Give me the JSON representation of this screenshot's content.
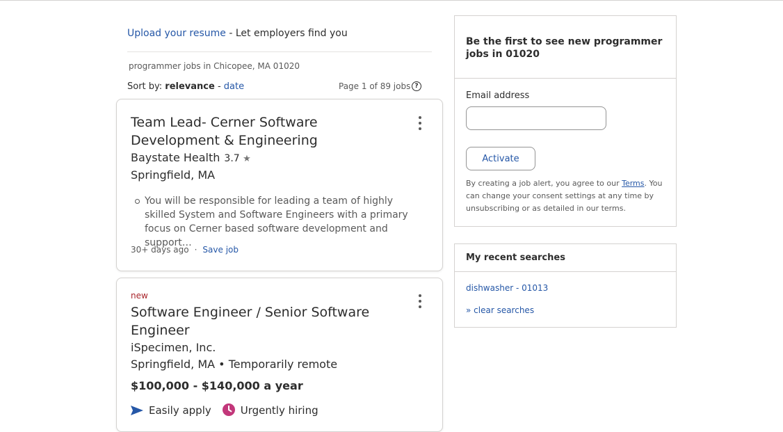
{
  "upload": {
    "link": "Upload your resume",
    "text": " - Let employers find you"
  },
  "search_location": "programmer jobs in Chicopee, MA 01020",
  "sort": {
    "label": "Sort by: ",
    "active": "relevance",
    "sep": " - ",
    "alt": "date"
  },
  "paging": {
    "text": "Page 1 of 89 jobs",
    "help_icon": "?"
  },
  "jobs": [
    {
      "title": "Team Lead- Cerner Software Development & Engineering",
      "company": "Baystate Health",
      "rating": "3.7",
      "star": "★",
      "location": "Springfield, MA",
      "snippet": "You will be responsible for leading a team of highly skilled System and Software Engineers with a primary focus on Cerner based software development and support…",
      "posted": "30+ days ago",
      "dot": "·",
      "save": "Save job"
    },
    {
      "badge": "new",
      "title": "Software Engineer / Senior Software Engineer",
      "company": "iSpecimen, Inc.",
      "location": "Springfield, MA  •  Temporarily remote",
      "salary": "$100,000 - $140,000 a year",
      "tag1": "Easily apply",
      "tag2": "Urgently hiring"
    }
  ],
  "alert": {
    "heading": "Be the first to see new programmer jobs in 01020",
    "email_label": "Email address",
    "email_value": "",
    "button": "Activate",
    "legal_pre": "By creating a job alert, you agree to our ",
    "legal_link": "Terms",
    "legal_post": ". You can change your consent settings at any time by unsubscribing or as detailed in our terms."
  },
  "recent": {
    "heading": "My recent searches",
    "items": [
      "dishwasher - 01013"
    ],
    "clear": "» clear searches"
  },
  "colors": {
    "link": "#2557a7",
    "new_badge": "#a9252b",
    "urgent_icon": "#c2377a"
  },
  "icons": [
    "help-icon",
    "star-icon",
    "kebab-menu-icon",
    "bullet-icon",
    "send-icon",
    "clock-icon"
  ]
}
